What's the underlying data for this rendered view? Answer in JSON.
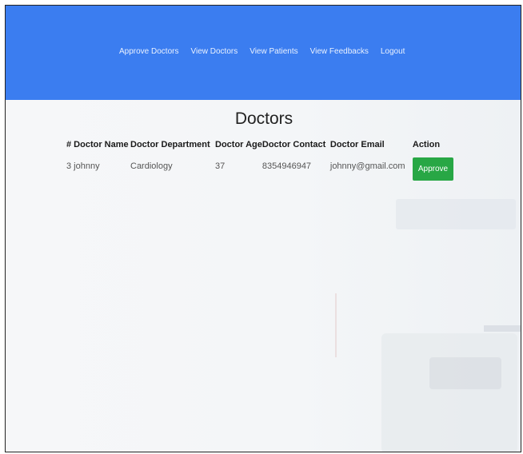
{
  "navbar": {
    "links": [
      "Approve Doctors",
      "View Doctors",
      "View Patients",
      "View Feedbacks",
      "Logout"
    ]
  },
  "page": {
    "title": "Doctors"
  },
  "table": {
    "headers": [
      "# Doctor Name",
      "Doctor Department",
      "Doctor Age",
      "Doctor Contact",
      "Doctor Email",
      "Action"
    ],
    "rows": [
      {
        "id_name": "3  johnny",
        "department": "Cardiology",
        "age": "37",
        "contact": "8354946947",
        "email": "johnny@gmail.com",
        "action_label": "Approve"
      }
    ]
  },
  "colors": {
    "navbar": "#3b7df0",
    "approve_button": "#28a745"
  }
}
